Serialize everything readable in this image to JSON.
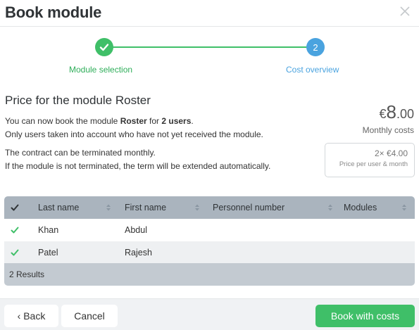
{
  "dialog": {
    "title": "Book module"
  },
  "stepper": {
    "steps": [
      {
        "label": "Module selection",
        "status": "done",
        "icon": "check-icon"
      },
      {
        "label": "Cost overview",
        "number": "2",
        "status": "current"
      }
    ],
    "colors": {
      "done": "#3fbf68",
      "current": "#4aa3df"
    }
  },
  "content": {
    "section_title": "Price for the module Roster",
    "para1": {
      "line1_a": "You can now book the module ",
      "line1_module": "Roster",
      "line1_b": " for ",
      "line1_users": "2 users",
      "line1_c": ".",
      "line2": "Only users taken into account who have not yet received the module."
    },
    "para2": {
      "line1": "The contract can be terminated monthly.",
      "line2": "If the module is not terminated, the term will be extended automatically."
    }
  },
  "price": {
    "currency": "€",
    "amount_int": "8",
    "amount_dec": ".00",
    "caption": "Monthly costs",
    "per_user_amount": "2× €4.00",
    "per_user_caption": "Price per user & month"
  },
  "table": {
    "columns": [
      "Last name",
      "First name",
      "Personnel number",
      "Modules"
    ],
    "rows": [
      {
        "selected": true,
        "last_name": "Khan",
        "first_name": "Abdul",
        "personnel_number": "",
        "modules": ""
      },
      {
        "selected": true,
        "last_name": "Patel",
        "first_name": "Rajesh",
        "personnel_number": "",
        "modules": ""
      }
    ],
    "footer": "2 Results"
  },
  "footer": {
    "back_label": "Back",
    "cancel_label": "Cancel",
    "book_label": "Book with costs"
  },
  "colors": {
    "accent_green": "#3fbf68",
    "accent_blue": "#4aa3df",
    "table_header": "#aab4be"
  }
}
